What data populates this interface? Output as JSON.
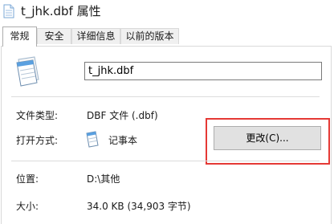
{
  "window": {
    "title": "t_jhk.dbf 属性"
  },
  "tabs": [
    {
      "label": "常规",
      "active": true
    },
    {
      "label": "安全",
      "active": false
    },
    {
      "label": "详细信息",
      "active": false
    },
    {
      "label": "以前的版本",
      "active": false
    }
  ],
  "general": {
    "file_name": "t_jhk.dbf",
    "file_type_label": "文件类型:",
    "file_type_value": "DBF 文件 (.dbf)",
    "opens_with_label": "打开方式:",
    "opens_with_app": "记事本",
    "change_button": "更改(C)...",
    "location_label": "位置:",
    "location_value": "D:\\其他",
    "size_label": "大小:",
    "size_value": "34.0 KB (34,903 字节)"
  },
  "colors": {
    "highlight": "#e53935",
    "button_bg": "#e1e1e1"
  },
  "icons": {
    "title": "file-icon",
    "file": "notepad-document-icon",
    "app": "notepad-icon"
  }
}
